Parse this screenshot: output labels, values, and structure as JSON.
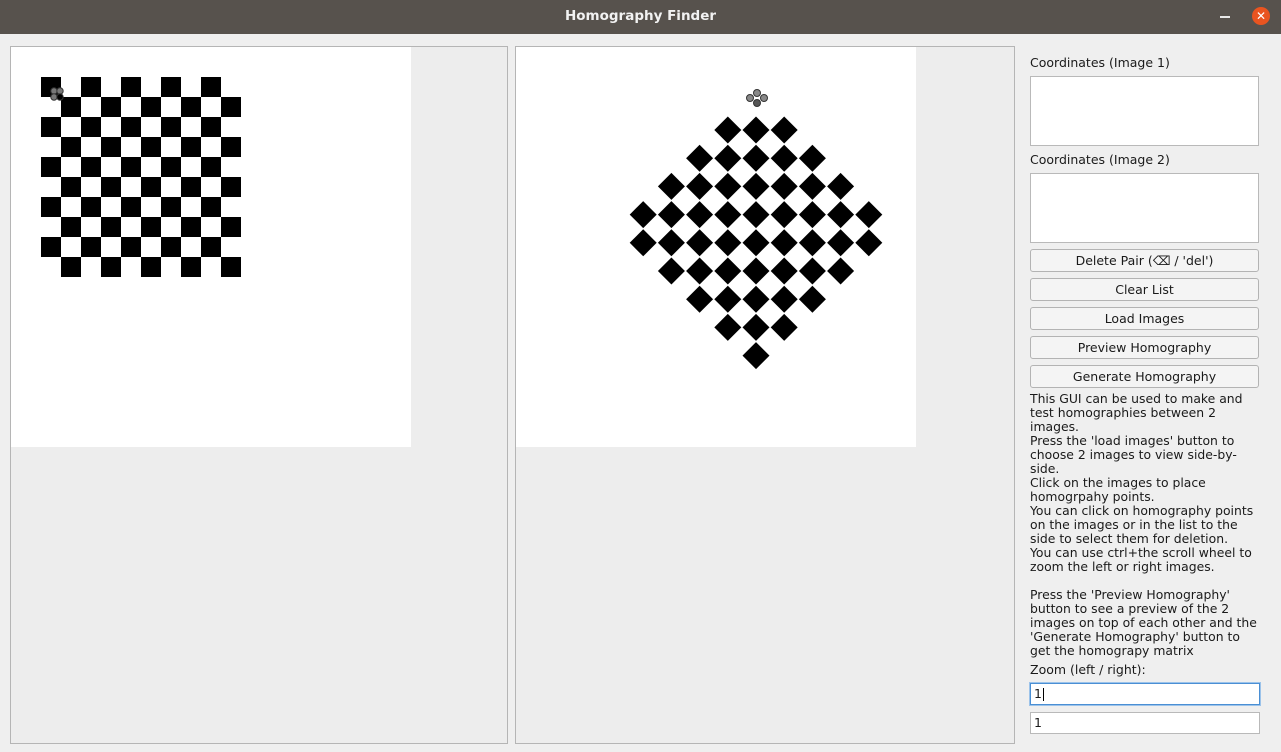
{
  "window": {
    "title": "Homography Finder",
    "minimize_icon": "minimize-icon",
    "close_icon": "close-icon",
    "close_color": "#e95420",
    "titlebar_color": "#57524d"
  },
  "side_panel": {
    "coords1_label": "Coordinates (Image 1)",
    "coords2_label": "Coordinates (Image 2)",
    "delete_pair_label": "Delete Pair (⌫ / 'del')",
    "clear_list_label": "Clear List",
    "load_images_label": "Load Images",
    "preview_label": "Preview Homography",
    "generate_label": "Generate Homography",
    "help_text": "This GUI can be used to make and test homographies between 2 images.\nPress the 'load images' button to choose 2 images to view side-by-side.\nClick on the images to place homogrpahy points.\nYou can click on homography points on the images or in the list to the side to select them for deletion.\nYou can use ctrl+the scroll wheel to zoom the left or right images.\n\nPress the 'Preview Homography' button to see a preview of the 2 images on top of each other and the 'Generate Homography' button to get the homograpy matrix",
    "zoom_label": "Zoom (left / right):",
    "zoom_left_value": "1",
    "zoom_right_value": "1"
  }
}
